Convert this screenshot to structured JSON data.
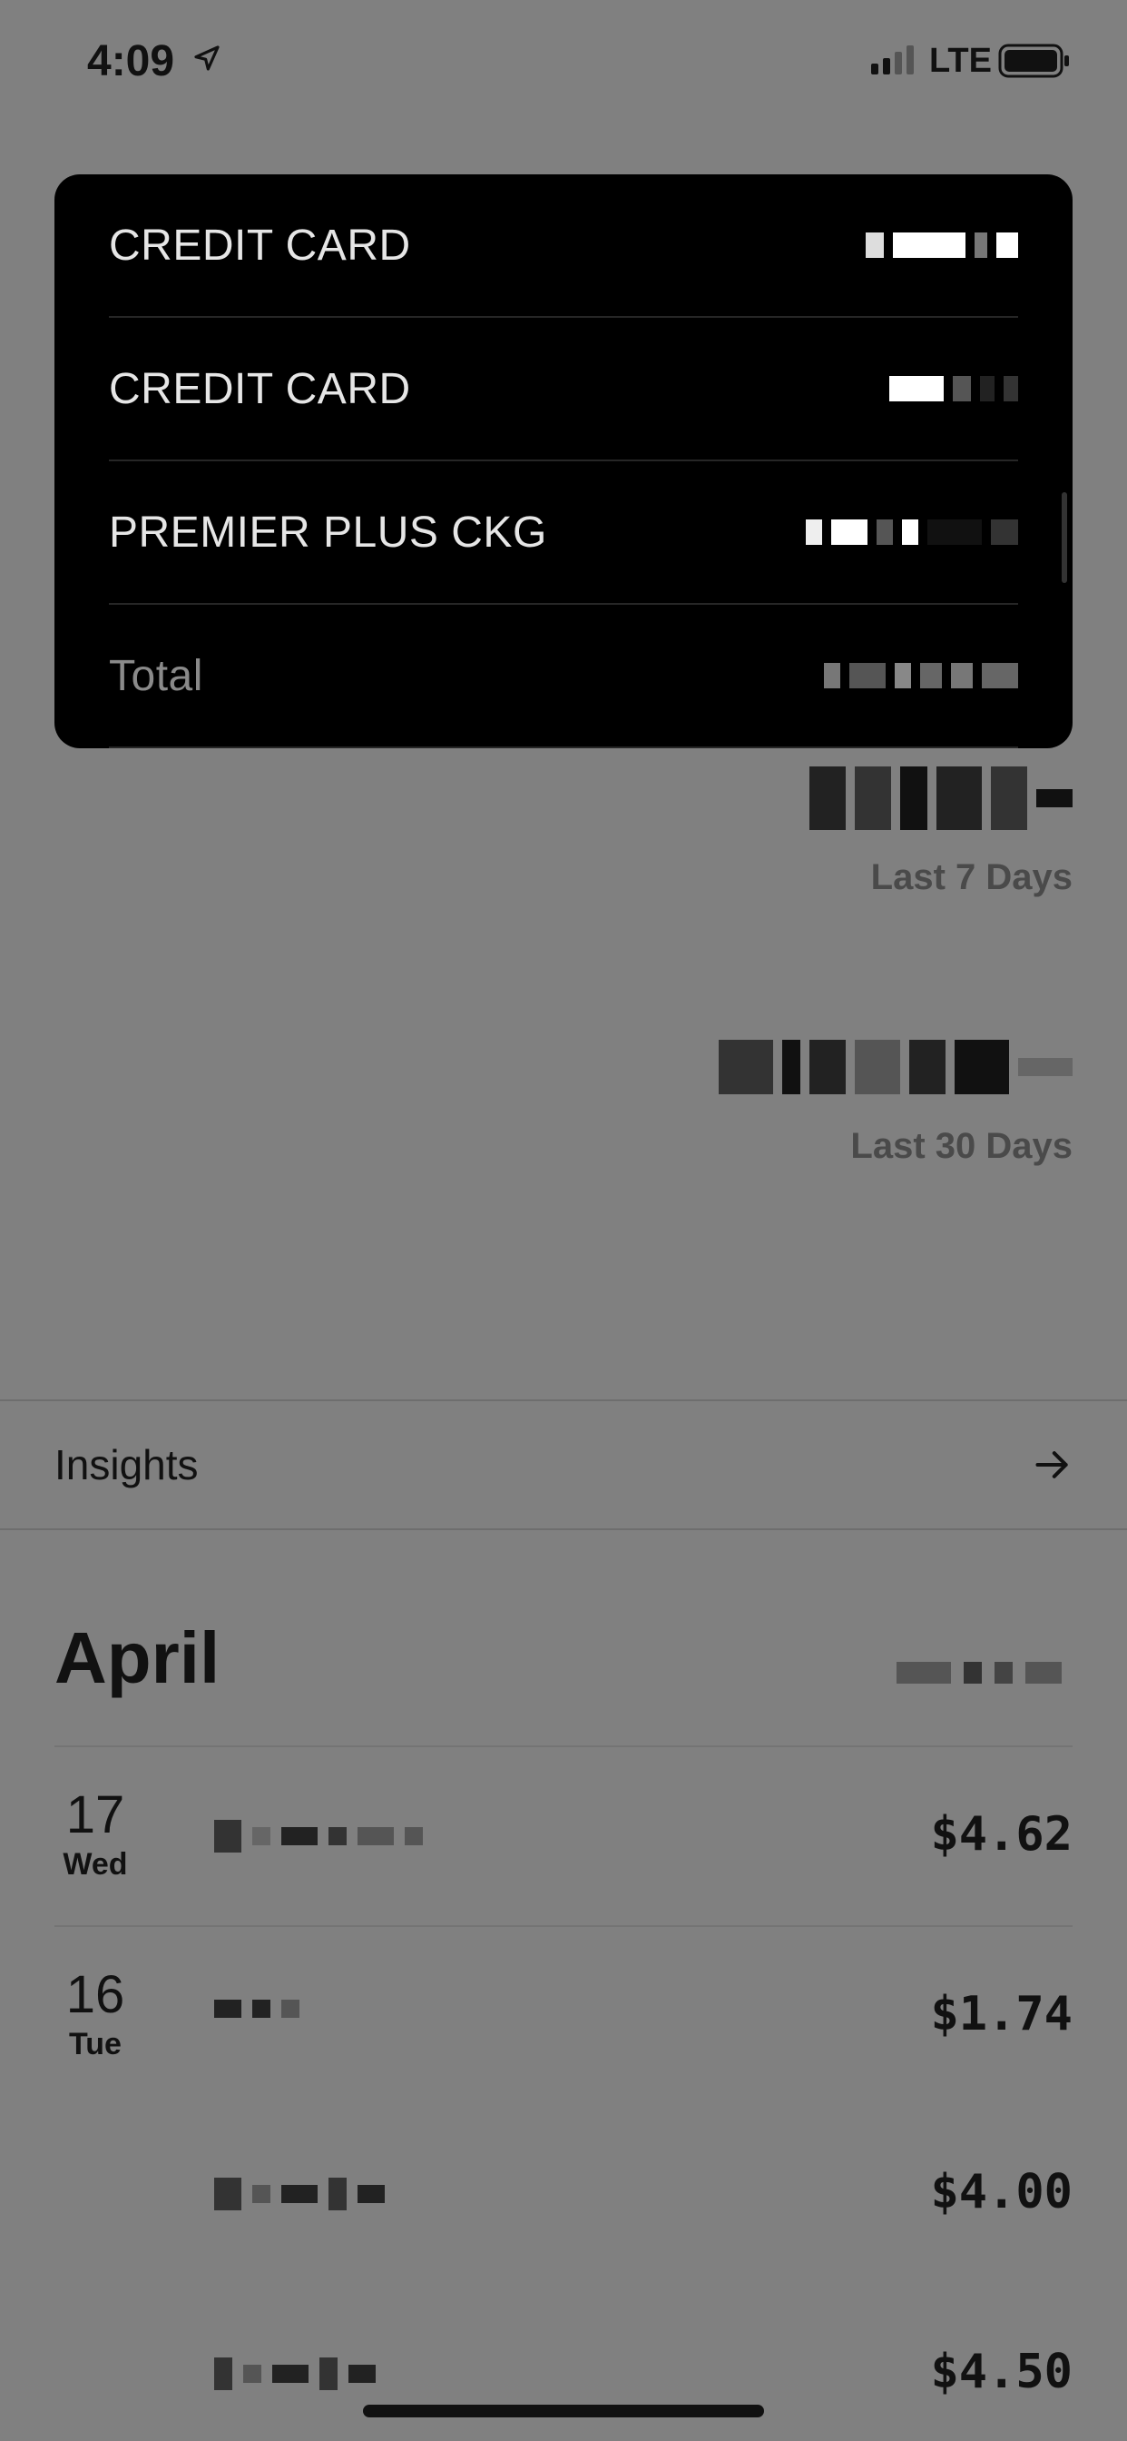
{
  "status_bar": {
    "time": "4:09",
    "network": "LTE",
    "icons": [
      "location-arrow-icon",
      "signal-icon",
      "battery-icon"
    ]
  },
  "accounts": [
    {
      "name": "CREDIT CARD"
    },
    {
      "name": "CREDIT CARD"
    },
    {
      "name": "PREMIER PLUS CKG"
    },
    {
      "name": "Total"
    }
  ],
  "summary": {
    "last7_label": "Last 7 Days",
    "last30_label": "Last 30 Days"
  },
  "insights": {
    "label": "Insights",
    "icon": "arrow-right-icon"
  },
  "month": {
    "title": "April"
  },
  "transactions": [
    {
      "day": "17",
      "weekday": "Wed",
      "amount": "$4.62"
    },
    {
      "day": "16",
      "weekday": "Tue",
      "amount": "$1.74"
    },
    {
      "day": "",
      "weekday": "",
      "amount": "$4.00"
    },
    {
      "day": "",
      "weekday": "",
      "amount": "$4.50"
    }
  ],
  "colors": {
    "background": "#808080",
    "card": "#000000",
    "text_primary": "#111111",
    "text_on_card": "#e6e6e6",
    "text_muted": "#4a4a4a"
  }
}
